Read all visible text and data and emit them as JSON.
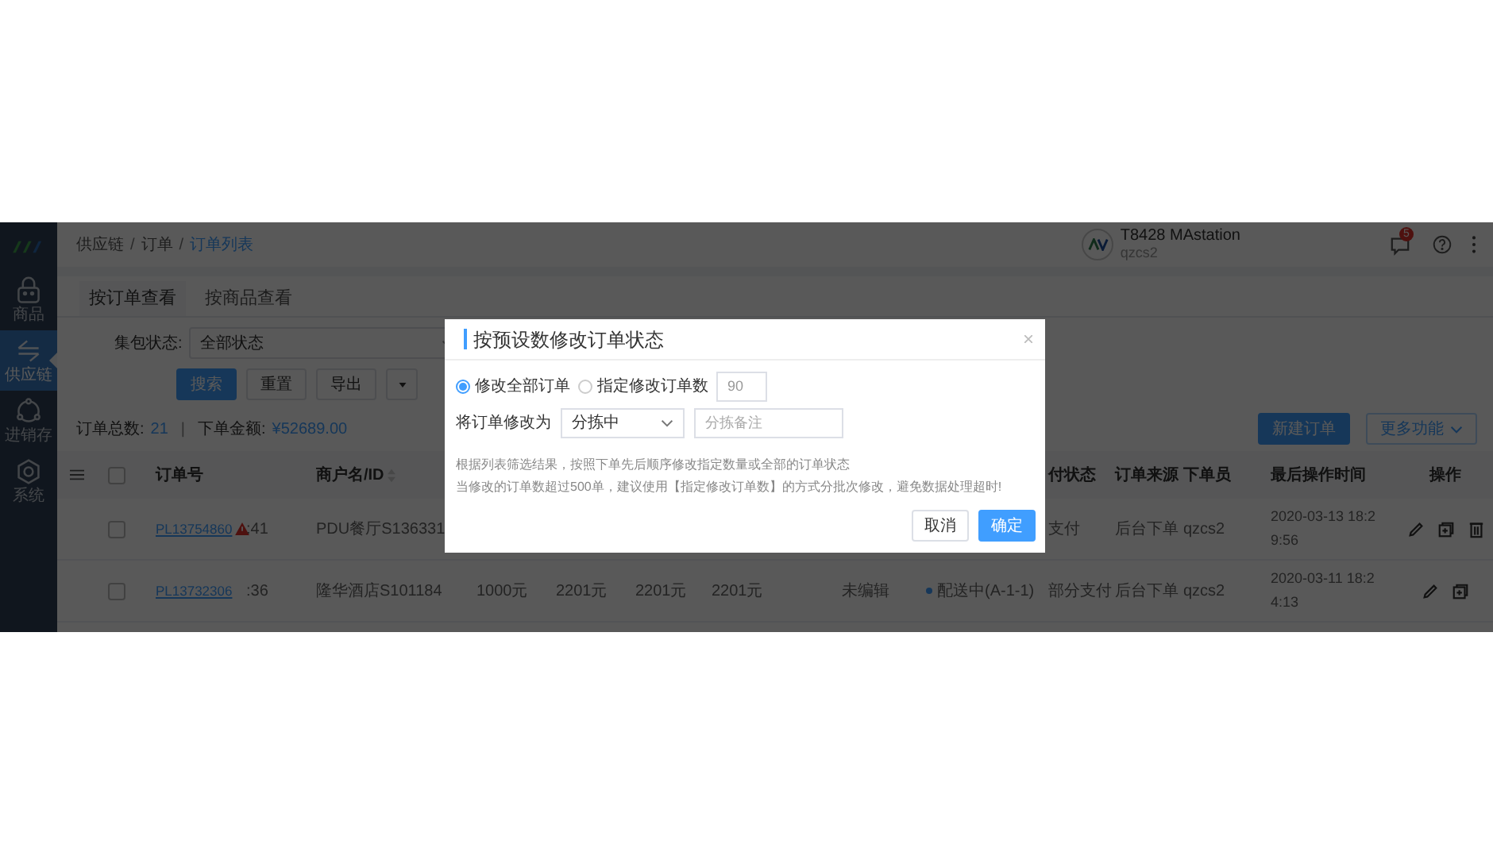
{
  "sidebar": {
    "items": [
      {
        "label": "商品",
        "kind": "basket",
        "selected": false
      },
      {
        "label": "供应链",
        "kind": "arrows",
        "selected": true
      },
      {
        "label": "进销存",
        "kind": "cycle",
        "selected": false
      },
      {
        "label": "系统",
        "kind": "gear",
        "selected": false
      }
    ]
  },
  "breadcrumb_separator": "/",
  "breadcrumb": [
    {
      "label": "供应链",
      "current": false
    },
    {
      "label": "订单",
      "current": false
    },
    {
      "label": "订单列表",
      "current": true
    }
  ],
  "account": {
    "name": "T8428 MAstation",
    "user": "qzcs2"
  },
  "message_badge": "5",
  "tabs": [
    {
      "label": "按订单查看",
      "selected": true
    },
    {
      "label": "按商品查看",
      "selected": false
    }
  ],
  "filter": {
    "label": "集包状态:",
    "value": "全部状态"
  },
  "filter_buttons": [
    {
      "label": "搜索",
      "kind": "primary"
    },
    {
      "label": "重置",
      "kind": "plain"
    },
    {
      "label": "导出",
      "kind": "plain"
    }
  ],
  "summary": {
    "count_label": "订单总数:",
    "count": "21",
    "separator": "|",
    "amount_label": "下单金额:",
    "amount": "¥52689.00"
  },
  "top_buttons": [
    {
      "label": "新建订单",
      "kind": "primary"
    },
    {
      "label": "更多功能",
      "kind": "menu"
    }
  ],
  "table": {
    "all_checked": false,
    "columns": [
      "订单号",
      null,
      "商户名/ID",
      null,
      null,
      null,
      null,
      null,
      null,
      "付状态",
      "订单来源",
      "下单员",
      "最后操作时间",
      "操作"
    ],
    "rows": [
      {
        "checked": false,
        "warning": true,
        "cells": [
          "PL13754860",
          ":41",
          "PDU餐厅S136331",
          null,
          null,
          null,
          null,
          null,
          null,
          "支付",
          "后台下单",
          "qzcs2",
          "2020-03-13 18:29:56"
        ],
        "actions": [
          {
            "kind": "edit"
          },
          {
            "kind": "copy"
          },
          {
            "kind": "delete"
          }
        ]
      },
      {
        "checked": false,
        "warning": false,
        "cells": [
          "PL13732306",
          ":36",
          "隆华酒店S101184",
          "1000元",
          "2201元",
          "2201元",
          "2201元",
          "未编辑",
          "配送中(A-1-1)",
          "部分支付",
          "后台下单",
          "qzcs2",
          "2020-03-11 18:24:13"
        ],
        "actions": [
          {
            "kind": "edit"
          },
          {
            "kind": "copy"
          }
        ]
      }
    ]
  },
  "dialog": {
    "title": "按预设数修改订单状态",
    "options": [
      {
        "label": "修改全部订单",
        "selected": true
      },
      {
        "label": "指定修改订单数",
        "selected": false
      }
    ],
    "count_value": "90",
    "status_label": "将订单修改为",
    "status_value": "分拣中",
    "note_placeholder": "分拣备注",
    "notes": [
      "根据列表筛选结果，按照下单先后顺序修改指定数量或全部的订单状态",
      "当修改的订单数超过500单，建议使用【指定修改订单数】的方式分批次修改，避免数据处理超时!"
    ],
    "buttons": [
      {
        "label": "取消",
        "kind": "plain"
      },
      {
        "label": "确定",
        "kind": "primary"
      }
    ]
  }
}
